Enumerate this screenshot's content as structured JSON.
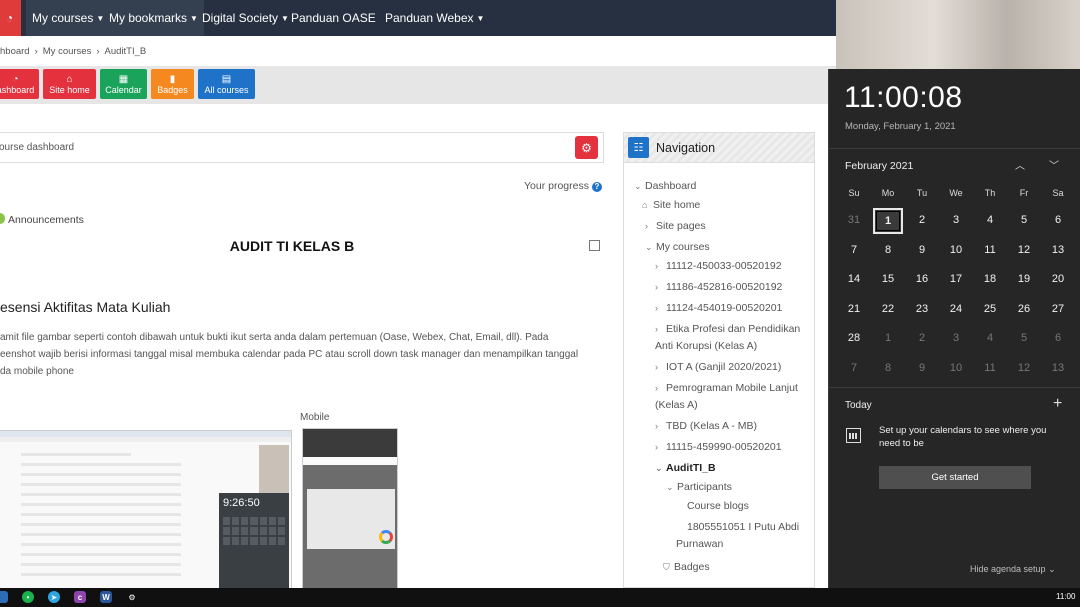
{
  "topnav": {
    "items": [
      "My courses",
      "My bookmarks",
      "Digital Society",
      "Panduan OASE",
      "Panduan Webex"
    ]
  },
  "breadcrumb": [
    "hboard",
    "My courses",
    "AuditTI_B"
  ],
  "quickbar": {
    "buttons": [
      {
        "label": "ashboard",
        "color": "#e3323e"
      },
      {
        "label": "Site home",
        "color": "#e3323e"
      },
      {
        "label": "Calendar",
        "color": "#1aa35b"
      },
      {
        "label": "Badges",
        "color": "#f5881f"
      },
      {
        "label": "All courses",
        "color": "#1e73c8"
      }
    ]
  },
  "course": {
    "dashboard_label": "ourse dashboard",
    "progress_label": "Your progress",
    "announcements": "Announcements",
    "title": "AUDIT TI KELAS B",
    "section_title": "esensi Aktifitas Mata Kuliah",
    "description_lines": [
      "amit file gambar seperti contoh dibawah untuk bukti ikut serta anda dalam pertemuan (Oase, Webex, Chat, Email, dll). Pada",
      "eenshot wajib berisi informasi tanggal misal membuka calendar pada PC atau scroll down task manager dan menampilkan tanggal",
      "da mobile phone"
    ],
    "mobile_label": "Mobile",
    "thumb_time": "9:26:50"
  },
  "navigation": {
    "title": "Navigation",
    "items": [
      {
        "text": "Dashboard",
        "arrow": "⌄"
      },
      {
        "text": "Site home",
        "arrow": "⌂"
      },
      {
        "text": "Site pages",
        "arrow": "›"
      },
      {
        "text": "My courses",
        "arrow": "⌄"
      },
      {
        "text": "11112-450033-00520192",
        "arrow": "›"
      },
      {
        "text": "11186-452816-00520192",
        "arrow": "›"
      },
      {
        "text": "11124-454019-00520201",
        "arrow": "›"
      },
      {
        "text": "Etika Profesi dan Pendidikan",
        "arrow": "›"
      },
      {
        "text": "Anti Korupsi (Kelas A)",
        "arrow": ""
      },
      {
        "text": "IOT A (Ganjil 2020/2021)",
        "arrow": "›"
      },
      {
        "text": "Pemrograman Mobile Lanjut",
        "arrow": "›"
      },
      {
        "text": "(Kelas A)",
        "arrow": ""
      },
      {
        "text": "TBD (Kelas A - MB)",
        "arrow": "›"
      },
      {
        "text": "11115-459990-00520201",
        "arrow": "›"
      },
      {
        "text": "AuditTI_B",
        "arrow": "⌄"
      },
      {
        "text": "Participants",
        "arrow": "⌄"
      },
      {
        "text": "Course blogs",
        "arrow": ""
      },
      {
        "text": "1805551051 I Putu Abdi",
        "arrow": ""
      },
      {
        "text": "Purnawan",
        "arrow": ""
      },
      {
        "text": "Badges",
        "arrow": "⛉"
      }
    ]
  },
  "clock": {
    "time": "11:00:08",
    "date": "Monday, February 1, 2021",
    "month": "February 2021",
    "weekdays": [
      "Su",
      "Mo",
      "Tu",
      "We",
      "Th",
      "Fr",
      "Sa"
    ],
    "weeks": [
      [
        "31",
        "1",
        "2",
        "3",
        "4",
        "5",
        "6"
      ],
      [
        "7",
        "8",
        "9",
        "10",
        "11",
        "12",
        "13"
      ],
      [
        "14",
        "15",
        "16",
        "17",
        "18",
        "19",
        "20"
      ],
      [
        "21",
        "22",
        "23",
        "24",
        "25",
        "26",
        "27"
      ],
      [
        "28",
        "1",
        "2",
        "3",
        "4",
        "5",
        "6"
      ],
      [
        "7",
        "8",
        "9",
        "10",
        "11",
        "12",
        "13"
      ]
    ],
    "selected_day": "1",
    "today_label": "Today",
    "setup_text": "Set up your calendars to see where you need to be",
    "get_started": "Get started",
    "hide_agenda": "Hide agenda setup"
  },
  "taskbar": {
    "clock": "11:00"
  }
}
